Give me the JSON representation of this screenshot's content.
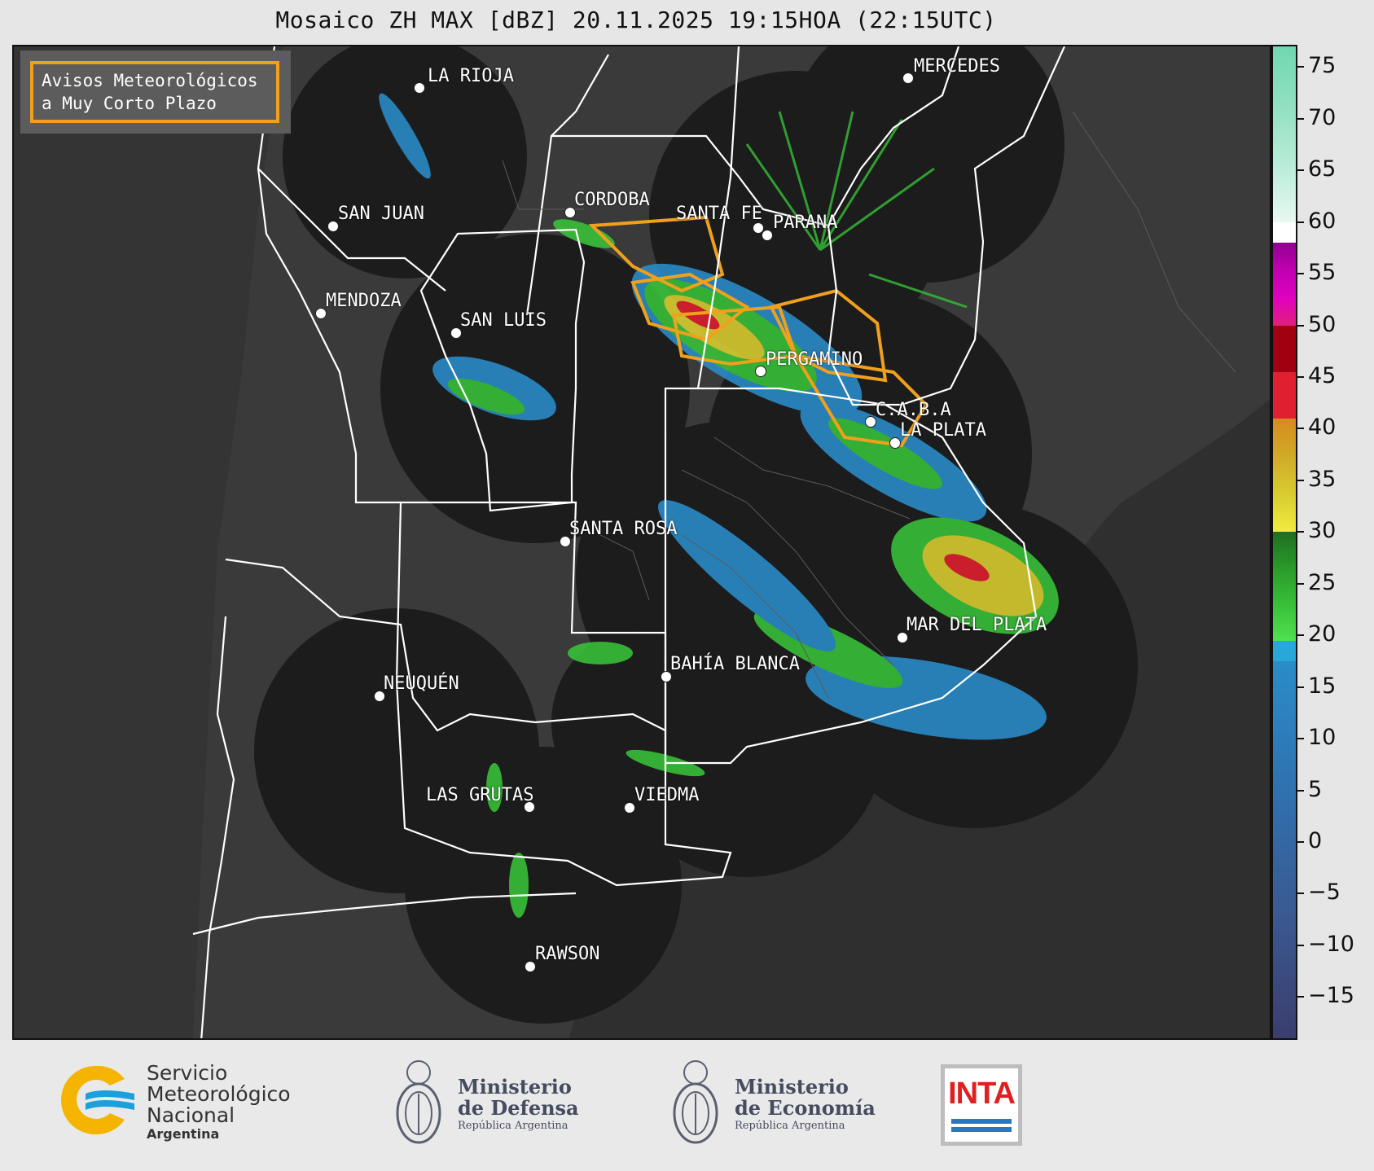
{
  "title": "Mosaico ZH MAX [dBZ] 20.11.2025 19:15HOA (22:15UTC)",
  "warning": {
    "line1": "Avisos Meteorológicos",
    "line2": "a Muy Corto Plazo"
  },
  "cities": [
    {
      "name": "LA RIOJA"
    },
    {
      "name": "MERCEDES"
    },
    {
      "name": "CORDOBA"
    },
    {
      "name": "SANTA FE"
    },
    {
      "name": "PARANA"
    },
    {
      "name": "SAN JUAN"
    },
    {
      "name": "MENDOZA"
    },
    {
      "name": "SAN LUIS"
    },
    {
      "name": "PERGAMINO"
    },
    {
      "name": "C.A.B.A"
    },
    {
      "name": "LA PLATA"
    },
    {
      "name": "SANTA ROSA"
    },
    {
      "name": "MAR DEL PLATA"
    },
    {
      "name": "BAHÍA BLANCA"
    },
    {
      "name": "NEUQUÉN"
    },
    {
      "name": "LAS GRUTAS"
    },
    {
      "name": "VIEDMA"
    },
    {
      "name": "RAWSON"
    }
  ],
  "colorbar": {
    "unit": "dBZ",
    "range": [
      -19,
      77
    ],
    "ticks": [
      "75",
      "70",
      "65",
      "60",
      "55",
      "50",
      "45",
      "40",
      "35",
      "30",
      "25",
      "20",
      "15",
      "10",
      "5",
      "0",
      "−5",
      "−10",
      "−15"
    ],
    "colors": [
      {
        "from": -19,
        "to": 17.5,
        "c": "#3a4a7a",
        "grad": [
          "#3b3d6e",
          "#3a5a92",
          "#2f72b0",
          "#2a8cc8"
        ]
      },
      {
        "from": 17.5,
        "to": 19.5,
        "c": "#28a8d8"
      },
      {
        "from": 19.5,
        "to": 30,
        "c": "#2a9a2a",
        "grad": [
          "#50e050",
          "#38c038",
          "#2a9a2a",
          "#1f6e1f"
        ]
      },
      {
        "from": 30,
        "to": 41,
        "c": "#d8c830",
        "grad": [
          "#f0ec40",
          "#d8cc30",
          "#d0aa28",
          "#d88a20"
        ]
      },
      {
        "from": 41,
        "to": 45.5,
        "c": "#e02030"
      },
      {
        "from": 45.5,
        "to": 50,
        "c": "#a00010"
      },
      {
        "from": 50,
        "to": 58,
        "c": "#d000a0",
        "grad": [
          "#e0207a",
          "#e000c0",
          "#c000b0",
          "#900090"
        ]
      },
      {
        "from": 58,
        "to": 60,
        "c": "#ffffff"
      },
      {
        "from": 60,
        "to": 77,
        "c": "#90e0c0",
        "grad": [
          "#e8f8f0",
          "#b8ecd8",
          "#90e0c0",
          "#70d8b0"
        ]
      }
    ]
  },
  "logos": {
    "smn_line1": "Servicio",
    "smn_line2": "Meteorológico",
    "smn_line3": "Nacional",
    "smn_line4": "Argentina",
    "defensa_line1": "Ministerio",
    "defensa_line2": "de Defensa",
    "defensa_line3": "República Argentina",
    "economia_line1": "Ministerio",
    "economia_line2": "de Economía",
    "economia_line3": "República Argentina",
    "inta": "INTA"
  }
}
